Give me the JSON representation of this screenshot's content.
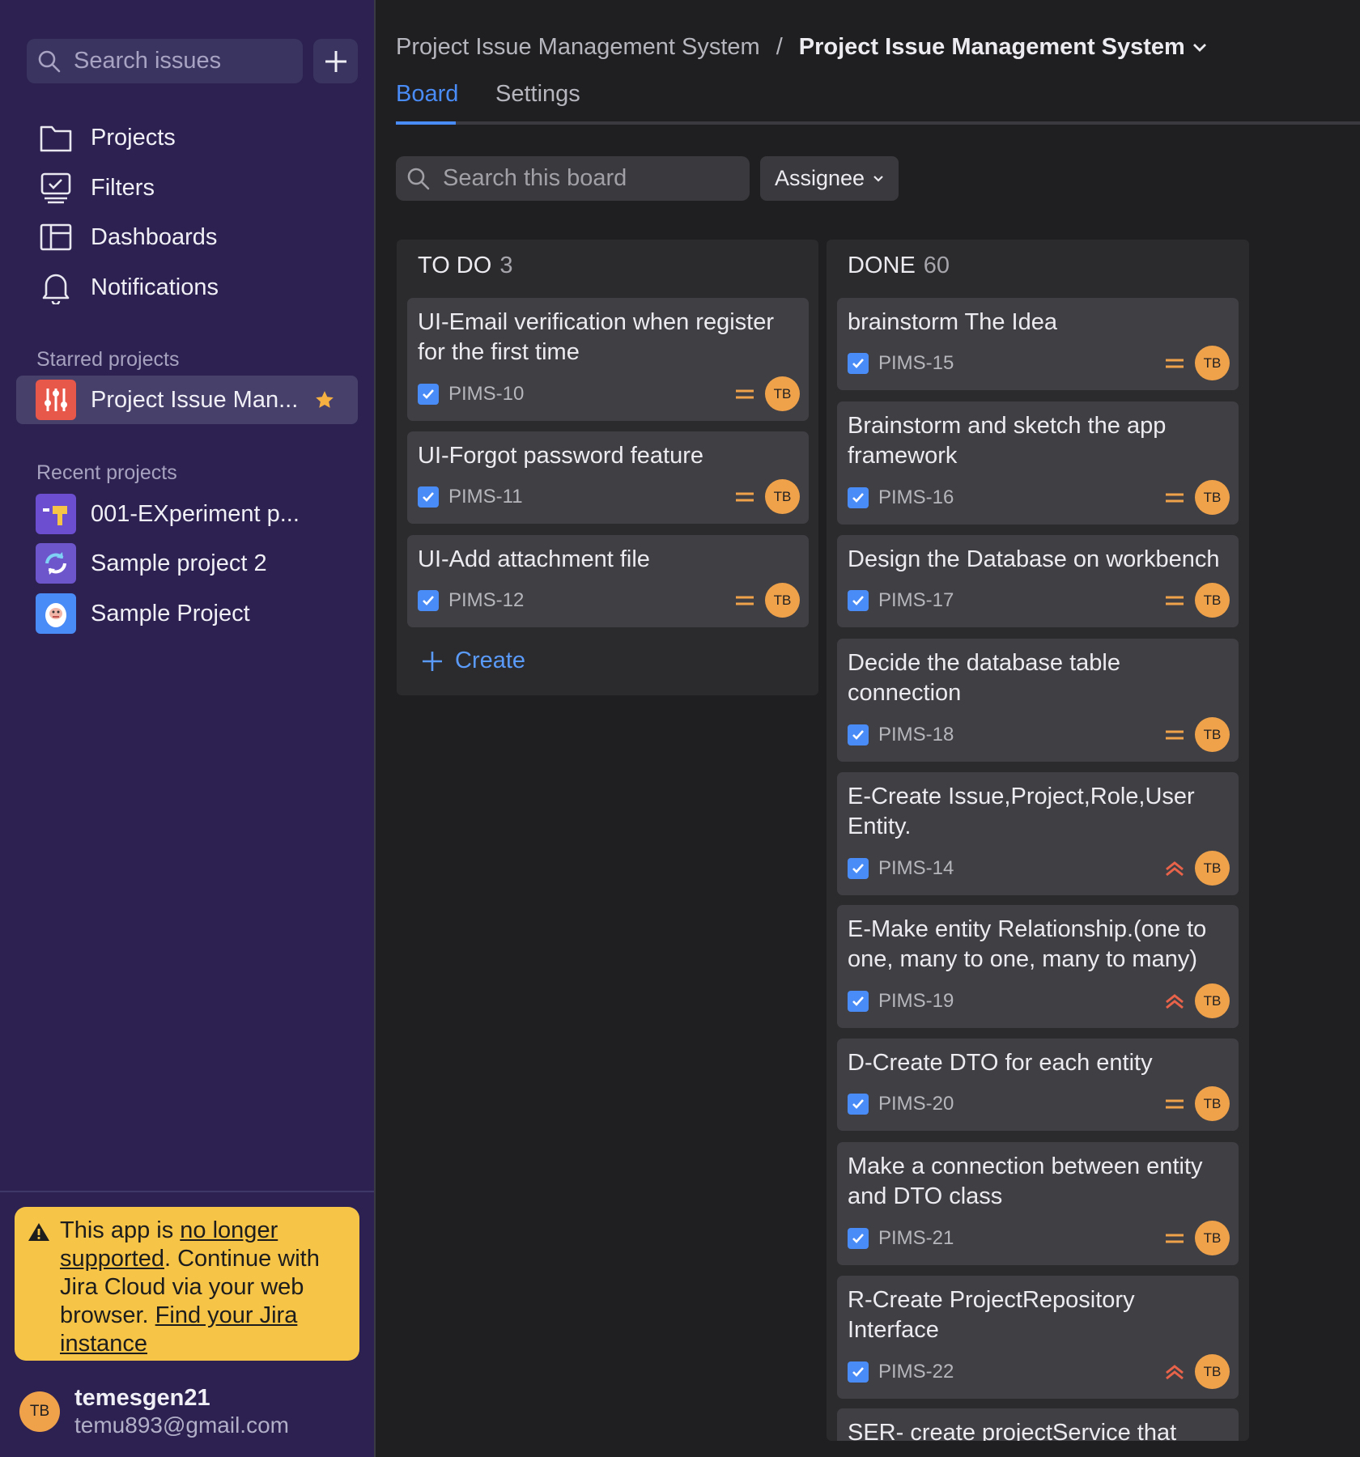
{
  "sidebar": {
    "search_placeholder": "Search issues",
    "nav": [
      {
        "label": "Projects",
        "icon": "folder-icon"
      },
      {
        "label": "Filters",
        "icon": "filter-monitor-icon"
      },
      {
        "label": "Dashboards",
        "icon": "dashboard-icon"
      },
      {
        "label": "Notifications",
        "icon": "bell-icon"
      }
    ],
    "starred_title": "Starred projects",
    "starred": [
      {
        "label": "Project Issue Man...",
        "icon": "project-sliders-icon"
      }
    ],
    "recent_title": "Recent projects",
    "recent": [
      {
        "label": "001-EXperiment p...",
        "icon": "project-hammer-icon"
      },
      {
        "label": "Sample project 2",
        "icon": "project-refresh-icon"
      },
      {
        "label": "Sample Project",
        "icon": "project-yeti-icon"
      }
    ],
    "warning": {
      "t1": "This app is ",
      "link1": "no longer supported",
      "t2": ". Continue with Jira Cloud via your web browser. ",
      "link2": "Find your Jira instance"
    },
    "user": {
      "initials": "TB",
      "name": "temesgen21",
      "email": "temu893@gmail.com"
    }
  },
  "header": {
    "breadcrumb_parent": "Project Issue Management System",
    "breadcrumb_sep": "/",
    "breadcrumb_current": "Project Issue Management System"
  },
  "tabs": [
    {
      "label": "Board",
      "active": true
    },
    {
      "label": "Settings",
      "active": false
    }
  ],
  "board": {
    "search_placeholder": "Search this board",
    "assignee_label": "Assignee",
    "create_label": "Create",
    "columns": [
      {
        "name": "TO DO",
        "count": "3",
        "cards": [
          {
            "title": "UI-Email verification when register for the first time",
            "key": "PIMS-10",
            "priority": "medium",
            "assignee": "TB"
          },
          {
            "title": "UI-Forgot password feature",
            "key": "PIMS-11",
            "priority": "medium",
            "assignee": "TB"
          },
          {
            "title": "UI-Add attachment file",
            "key": "PIMS-12",
            "priority": "medium",
            "assignee": "TB"
          }
        ]
      },
      {
        "name": "DONE",
        "count": "60",
        "cards": [
          {
            "title": "brainstorm The Idea",
            "key": "PIMS-15",
            "priority": "medium",
            "assignee": "TB"
          },
          {
            "title": "Brainstorm and sketch the app framework",
            "key": "PIMS-16",
            "priority": "medium",
            "assignee": "TB"
          },
          {
            "title": "Design the Database on workbench",
            "key": "PIMS-17",
            "priority": "medium",
            "assignee": "TB"
          },
          {
            "title": "Decide the database table connection",
            "key": "PIMS-18",
            "priority": "medium",
            "assignee": "TB"
          },
          {
            "title": "E-Create Issue,Project,Role,User Entity.",
            "key": "PIMS-14",
            "priority": "high",
            "assignee": "TB"
          },
          {
            "title": "E-Make entity Relationship.(one to one, many to one, many to many)",
            "key": "PIMS-19",
            "priority": "high",
            "assignee": "TB"
          },
          {
            "title": "D-Create DTO for each entity",
            "key": "PIMS-20",
            "priority": "medium",
            "assignee": "TB"
          },
          {
            "title": "Make a connection between entity and DTO class",
            "key": "PIMS-21",
            "priority": "medium",
            "assignee": "TB"
          },
          {
            "title": "R-Create ProjectRepository Interface",
            "key": "PIMS-22",
            "priority": "high",
            "assignee": "TB"
          },
          {
            "title": "SER- create projectService that",
            "key": "",
            "priority": "",
            "assignee": ""
          }
        ]
      }
    ]
  },
  "colors": {
    "accent": "#4a8cf7",
    "sidebar": "#2c2150",
    "warning": "#f6c447",
    "avatar": "#f0a24b",
    "priority_medium": "#f0a24b",
    "priority_high": "#e8634a"
  }
}
